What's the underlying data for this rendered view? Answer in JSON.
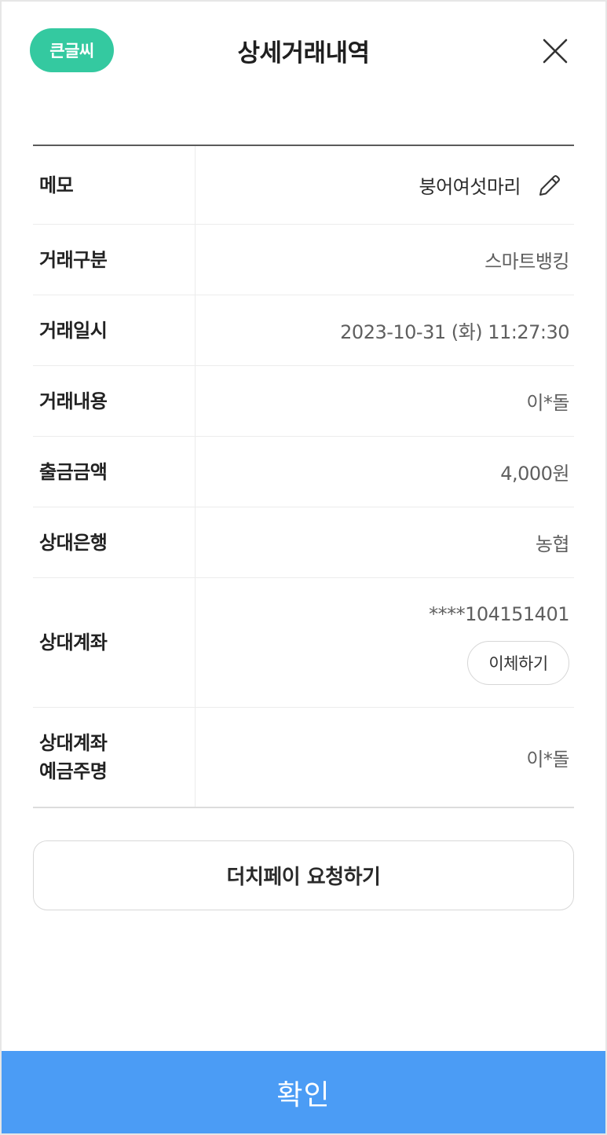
{
  "header": {
    "big_font_label": "큰글씨",
    "title": "상세거래내역",
    "close_icon": "close-icon"
  },
  "details": {
    "memo": {
      "label": "메모",
      "value": "붕어여섯마리",
      "edit_icon": "pencil-icon"
    },
    "type": {
      "label": "거래구분",
      "value": "스마트뱅킹"
    },
    "datetime": {
      "label": "거래일시",
      "value": "2023-10-31 (화) 11:27:30"
    },
    "description": {
      "label": "거래내용",
      "value": "이*돌"
    },
    "amount": {
      "label": "출금금액",
      "value": "4,000원"
    },
    "bank": {
      "label": "상대은행",
      "value": "농협"
    },
    "account": {
      "label": "상대계좌",
      "value": "****104151401",
      "transfer_label": "이체하기"
    },
    "holder": {
      "label_line1": "상대계좌",
      "label_line2": "예금주명",
      "value": "이*돌"
    }
  },
  "actions": {
    "dutch_pay_label": "더치페이 요청하기",
    "confirm_label": "확인"
  },
  "colors": {
    "big_font_badge": "#34c9a0",
    "confirm_button": "#4b9cf5"
  }
}
